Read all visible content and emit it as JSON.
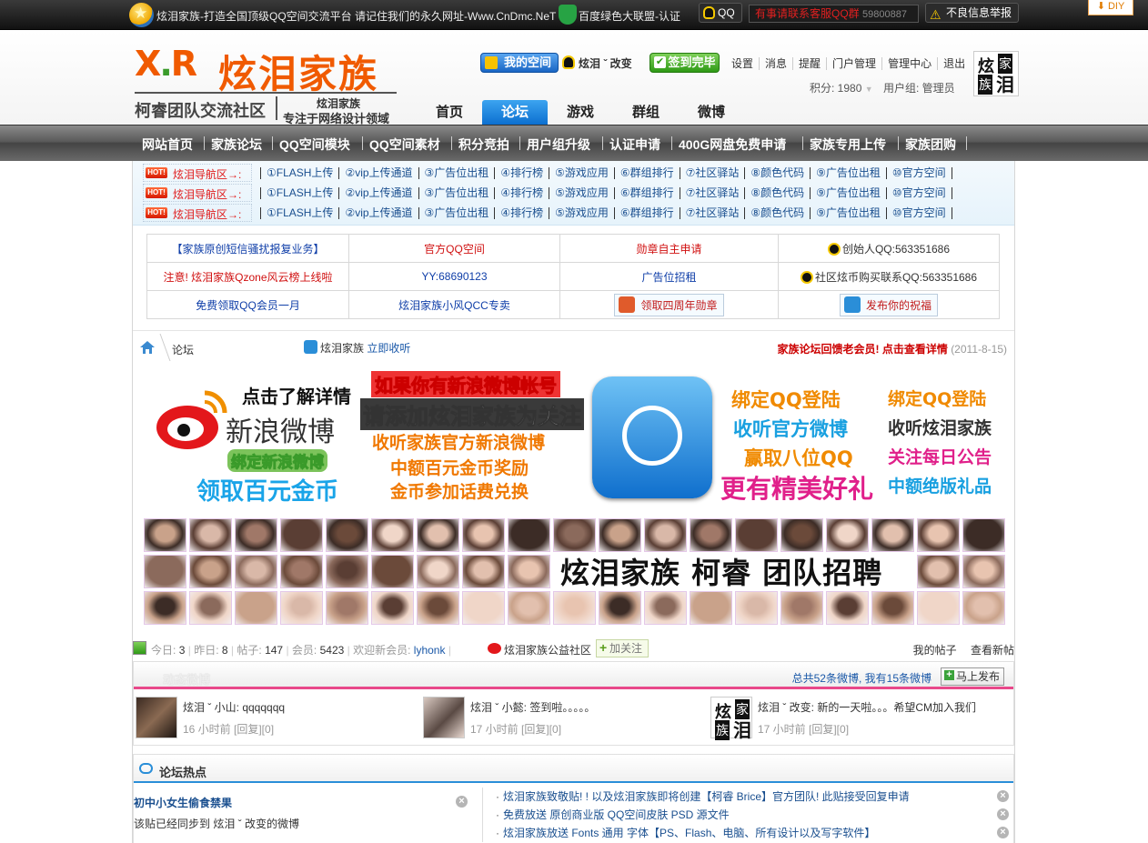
{
  "topbar": {
    "notice": "炫泪家族-打造全国顶级QQ空间交流平台 请记住我们的永久网址-Www.CnDmc.NeT",
    "union": "百度绿色大联盟-认证",
    "qq": "QQ",
    "kefu": "有事请联系客服QQ群",
    "kefu_num": "59800887",
    "report": "不良信息举报",
    "diy": "DIY"
  },
  "logo": {
    "xr": "X.R",
    "name": "炫泪家族",
    "slogan": "柯睿团队交流社区",
    "sub1": "炫泪家族",
    "sub2": "专注于网络设计领域"
  },
  "user": {
    "myspace": "我的空间",
    "nick": "炫泪 ˇ 改变",
    "checkin": "签到完毕",
    "menu": [
      "设置",
      "消息",
      "提醒",
      "门户管理",
      "管理中心",
      "退出"
    ],
    "credits": "积分: 1980",
    "group": "用户组: 管理员",
    "avatar_text": [
      "炫",
      "家",
      "族",
      "泪"
    ]
  },
  "mainnav": [
    "首页",
    "论坛",
    "游戏",
    "群组",
    "微博"
  ],
  "catbar": [
    "网站首页",
    "家族论坛",
    "QQ空间模块",
    "QQ空间素材",
    "积分竞拍",
    "用户组升级",
    "认证申请",
    "400G网盘免费申请",
    "家族专用上传",
    "家族团购"
  ],
  "navrows": {
    "hot": "HOT!",
    "lead": "炫泪导航区→:",
    "links": [
      "①FLASH上传",
      "②vip上传通道",
      "③广告位出租",
      "④排行榜",
      "⑤游戏应用",
      "⑥群组排行",
      "⑦社区驿站",
      "⑧颜色代码",
      "⑨广告位出租",
      "⑩官方空间"
    ]
  },
  "adtable": {
    "rows": [
      [
        "【家族原创短信骚扰报复业务】",
        "官方QQ空间",
        "勋章自主申请",
        "创始人QQ:563351686"
      ],
      [
        "注意! 炫泪家族Qzone风云榜上线啦",
        "YY:68690123",
        "广告位招租",
        "社区炫币购买联系QQ:563351686"
      ],
      [
        "免费领取QQ会员一月",
        "炫泪家族小风QCC专卖",
        "领取四周年勋章",
        "发布你的祝福"
      ]
    ]
  },
  "crumb": {
    "current": "论坛",
    "tweet_name": "炫泪家族",
    "tweet_link": "立即收听",
    "announce": "家族论坛回馈老会员! 点击查看详情",
    "date": "(2011-8-15)"
  },
  "banner": {
    "lines": [
      "点击了解详情",
      "新浪微博",
      "绑定新浪微博",
      "领取百元金币",
      "如果你有新浪微博帐号",
      "请添加炫泪家族为关注",
      "收听家族官方新浪微博",
      "中额百元金币奖励",
      "金币参加话费兑换",
      "绑定QQ登陆",
      "收听官方微博",
      "赢取八位QQ",
      "更有精美好礼",
      "绑定QQ登陆",
      "收听炫泪家族",
      "关注每日公告",
      "中额绝版礼品"
    ]
  },
  "recruit": "炫泪家族  柯睿  团队招聘",
  "stats": {
    "today_label": "今日:",
    "today": "3",
    "yesterday_label": "昨日:",
    "yesterday": "8",
    "posts_label": "帖子:",
    "posts": "147",
    "members_label": "会员:",
    "members": "5423",
    "welcome_label": "欢迎新会员:",
    "new_member": "lyhonk",
    "community": "炫泪家族公益社区",
    "follow": "加关注",
    "my_posts": "我的帖子",
    "new_posts": "查看新帖"
  },
  "weibo": {
    "title": "动态微博",
    "count": "总共52条微博, 我有15条微博",
    "post": "马上发布",
    "items": [
      {
        "who": "炫泪 ˇ 小山: qqqqqqq",
        "meta": "16 小时前 [回复][0]"
      },
      {
        "who": "炫泪 ˇ 小懿: 签到啦。。。。。",
        "meta": "17 小时前 [回复][0]"
      },
      {
        "who": "炫泪 ˇ 改变: 新的一天啦。。。希望CM加入我们",
        "meta": "17 小时前 [回复][0]"
      }
    ]
  },
  "hot": {
    "title": "论坛热点",
    "left_title": "初中小女生偷食禁果",
    "left_text": "该贴已经同步到 炫泪 ˇ 改变的微博",
    "list": [
      "炫泪家族致敬贴! ! 以及炫泪家族即将创建【柯睿 Brice】官方团队! 此贴接受回复申请",
      "免费放送 原创商业版 QQ空间皮肤 PSD 源文件",
      "炫泪家族放送 Fonts 通用 字体【PS、Flash、电脑、所有设计以及写字软件】"
    ]
  },
  "colors": {
    "accent": "#f05a00",
    "link": "#1a4f8f",
    "red": "#d01010",
    "nav_active": "#0c6fd0"
  }
}
